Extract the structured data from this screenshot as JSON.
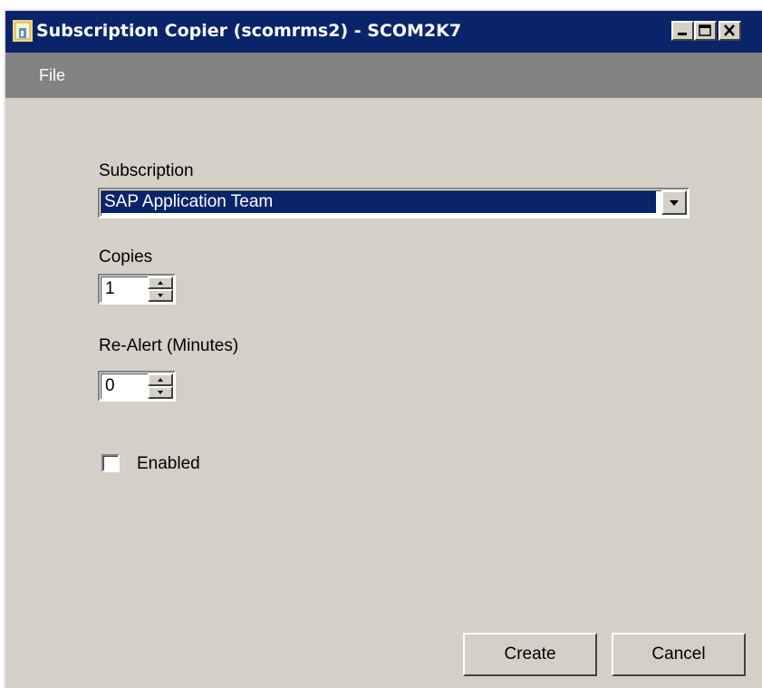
{
  "window": {
    "title": "Subscription Copier (scomrms2) - SCOM2K7",
    "controls": [
      "minimize-icon",
      "maximize-icon",
      "close-icon"
    ]
  },
  "menu": {
    "file": "File"
  },
  "form": {
    "subscription_label": "Subscription",
    "subscription_value": "SAP Application Team",
    "copies_label": "Copies",
    "copies_value": "1",
    "realert_label": "Re-Alert (Minutes)",
    "realert_value": "0",
    "enabled_label": "Enabled",
    "enabled_checked": false
  },
  "buttons": {
    "create": "Create",
    "cancel": "Cancel"
  },
  "colors": {
    "titlebar": "#0a246a",
    "menubar": "#838383",
    "window_bg": "#d4d0c8",
    "selection": "#0a246a"
  }
}
